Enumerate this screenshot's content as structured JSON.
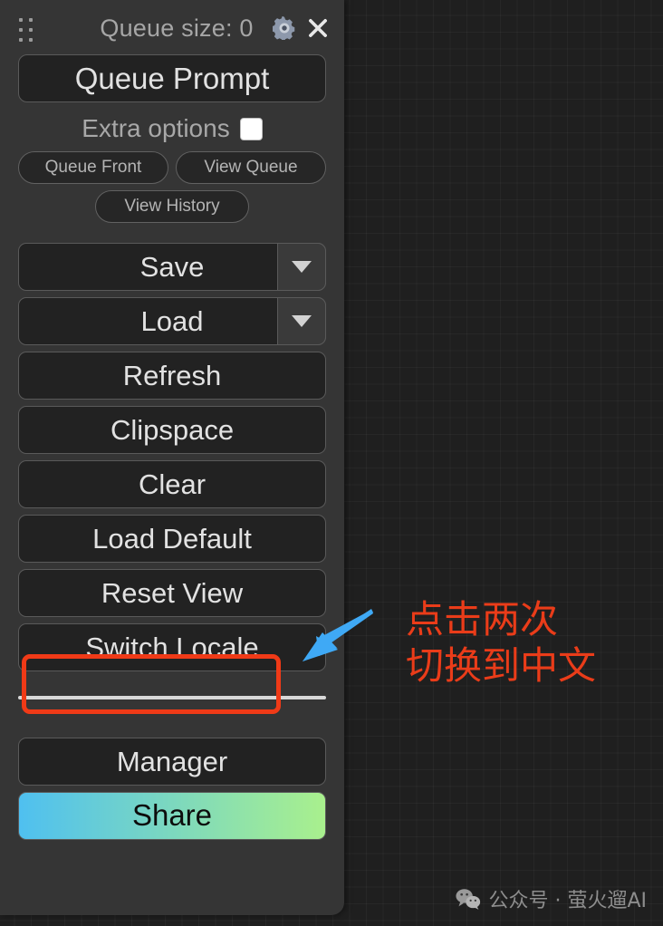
{
  "panel": {
    "header": {
      "drag_handle_name": "drag-handle",
      "queue_size_label": "Queue size: 0",
      "gear_icon": "gear-icon",
      "close_icon": "close-icon"
    },
    "queue_prompt_label": "Queue Prompt",
    "extra_options": {
      "label": "Extra options",
      "checked": false
    },
    "pill_buttons": [
      {
        "label": "Queue Front"
      },
      {
        "label": "View Queue"
      },
      {
        "label": "View History"
      }
    ],
    "action_buttons": [
      {
        "label": "Save",
        "has_dropdown": true
      },
      {
        "label": "Load",
        "has_dropdown": true
      },
      {
        "label": "Refresh",
        "has_dropdown": false
      },
      {
        "label": "Clipspace",
        "has_dropdown": false
      },
      {
        "label": "Clear",
        "has_dropdown": false
      },
      {
        "label": "Load Default",
        "has_dropdown": false
      },
      {
        "label": "Reset View",
        "has_dropdown": false
      },
      {
        "label": "Switch Locale",
        "has_dropdown": false,
        "highlighted": true
      }
    ],
    "bottom_buttons": [
      {
        "label": "Manager",
        "style": "default"
      },
      {
        "label": "Share",
        "style": "gradient"
      }
    ]
  },
  "annotation": {
    "line1": "点击两次",
    "line2": "切换到中文",
    "arrow_name": "blue-arrow-pointer"
  },
  "watermark": {
    "icon": "wechat-icon",
    "text": "公众号 · 萤火遛AI"
  },
  "colors": {
    "panel_bg": "#353535",
    "button_bg": "#222222",
    "button_border": "#5a5a5a",
    "text": "#e2e2e2",
    "muted_text": "#a6a6a6",
    "highlight_red": "#f03a17",
    "annotation_red": "#ea3c19",
    "arrow_blue": "#3fa9f5",
    "share_gradient_start": "#4fc0f0",
    "share_gradient_end": "#a9f08d",
    "canvas_bg": "#1f1f1f"
  }
}
